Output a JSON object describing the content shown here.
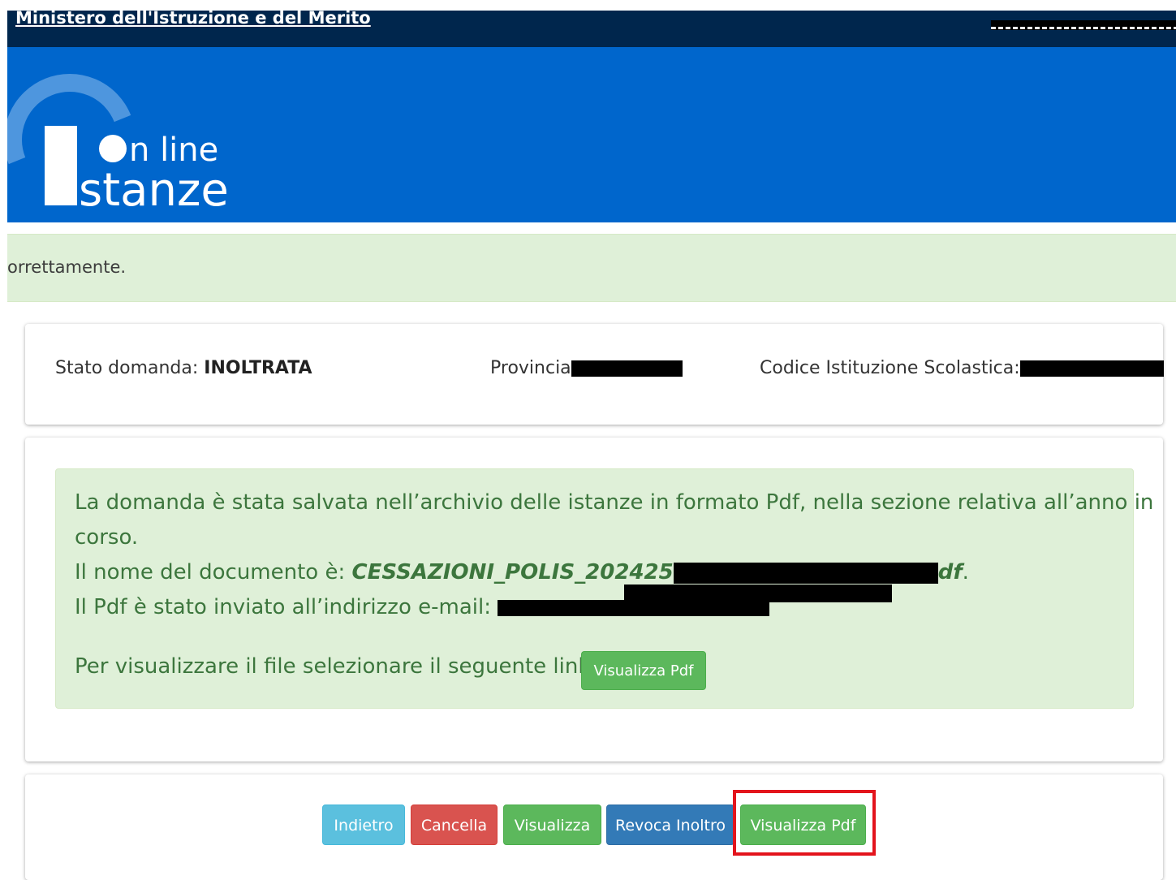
{
  "top_bar": {
    "ministry_link": "Ministero dell'Istruzione e del Merito"
  },
  "logo": {
    "line1": "n line",
    "line2": "stanze"
  },
  "success_banner": {
    "text": "orrettamente."
  },
  "status_card": {
    "stato_label": "Stato domanda: ",
    "stato_value": "INOLTRATA",
    "provincia_label": "Provincia",
    "codice_label": "Codice Istituzione Scolastica:"
  },
  "message_card": {
    "line1": "La domanda è stata salvata nell’archivio delle istanze in formato Pdf, nella sezione relativa all’anno in",
    "line2": "corso.",
    "doc_label": "Il nome del documento è: ",
    "doc_name_start": "CESSAZIONI_POLIS_202425",
    "doc_name_end": "df",
    "doc_suffix": ".",
    "email_label": "Il Pdf è stato inviato all’indirizzo e-mail: ",
    "link_label": "Per visualizzare il file selezionare il seguente link: ",
    "link_button": "Visualizza Pdf"
  },
  "actions": {
    "indietro": "Indietro",
    "cancella": "Cancella",
    "visualizza": "Visualizza",
    "revoca": "Revoca Inoltro",
    "visualizza_pdf": "Visualizza Pdf"
  },
  "colors": {
    "top_bar": "#00264d",
    "header": "#0066cc",
    "success_bg": "#dff0d8",
    "success_text": "#3c763d",
    "highlight": "#e3141c"
  }
}
